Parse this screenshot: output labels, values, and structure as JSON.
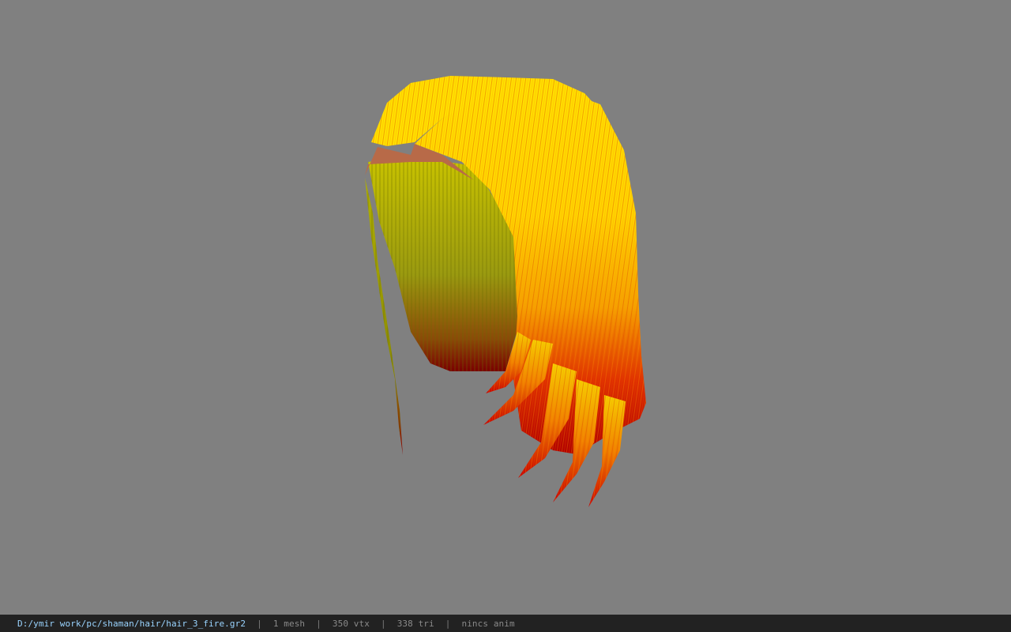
{
  "viewport": {
    "background_color": "#808080",
    "model": "hair-mesh",
    "texture_colors": {
      "yellow": "#ffe600",
      "orange": "#ff9a00",
      "red": "#d01800",
      "dark_red": "#7e0000",
      "olive": "#a8a800",
      "skin": "#b86a48"
    }
  },
  "statusbar": {
    "file_path": "D:/ymir work/pc/shaman/hair/hair_3_fire.gr2",
    "separator": "|",
    "mesh": "1 mesh",
    "vertices": "350 vtx",
    "triangles": "338 tri",
    "anim": "nincs anim",
    "path_color": "#9ad4ff"
  }
}
